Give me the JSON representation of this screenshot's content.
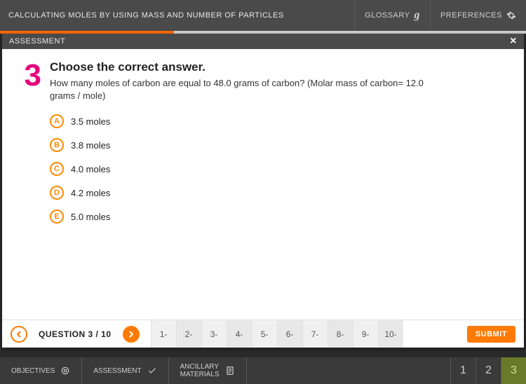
{
  "topbar": {
    "title": "CALCULATING MOLES BY USING MASS AND NUMBER OF PARTICLES",
    "glossary": "GLOSSARY",
    "preferences": "PREFERENCES"
  },
  "panel": {
    "header": "ASSESSMENT"
  },
  "question": {
    "number": "3",
    "title": "Choose the correct answer.",
    "text": "How many moles of carbon are equal to 48.0 grams of carbon? (Molar mass of carbon= 12.0 grams / mole)",
    "choices": [
      {
        "letter": "A",
        "text": "3.5 moles"
      },
      {
        "letter": "B",
        "text": "3.8 moles"
      },
      {
        "letter": "C",
        "text": "4.0 moles"
      },
      {
        "letter": "D",
        "text": "4.2 moles"
      },
      {
        "letter": "E",
        "text": "5.0 moles"
      }
    ]
  },
  "nav": {
    "counter": "QUESTION 3 / 10",
    "tabs": [
      "1-",
      "2-",
      "3-",
      "4-",
      "5-",
      "6-",
      "7-",
      "8-",
      "9-",
      "10-"
    ],
    "submit": "SUBMIT"
  },
  "bottom": {
    "objectives": "OBJECTIVES",
    "assessment": "ASSESSMENT",
    "ancillary1": "ANCILLARY",
    "ancillary2": "MATERIALS",
    "pages": [
      "1",
      "2",
      "3"
    ],
    "active_page": "3"
  }
}
